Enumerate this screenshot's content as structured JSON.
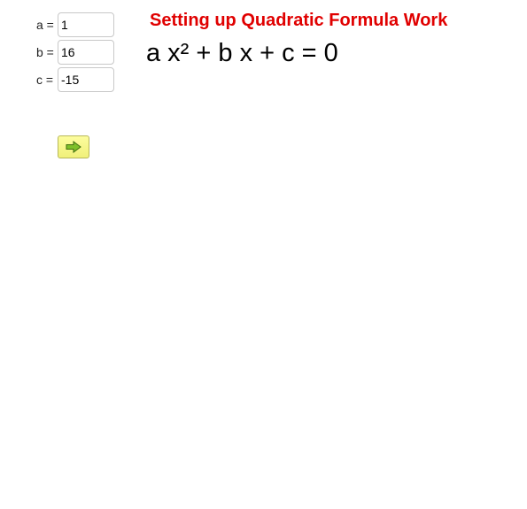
{
  "title": "Setting up Quadratic Formula Work",
  "equation": "a x² + b x + c = 0",
  "inputs": {
    "a": {
      "label": "a =",
      "value": "1"
    },
    "b": {
      "label": "b =",
      "value": "16"
    },
    "c": {
      "label": "c =",
      "value": "-15"
    }
  },
  "next_button": {
    "icon": "right-arrow-icon"
  },
  "colors": {
    "title": "#e00000",
    "button_fill": "#f6f68a",
    "arrow_fill": "#7ec02a"
  }
}
